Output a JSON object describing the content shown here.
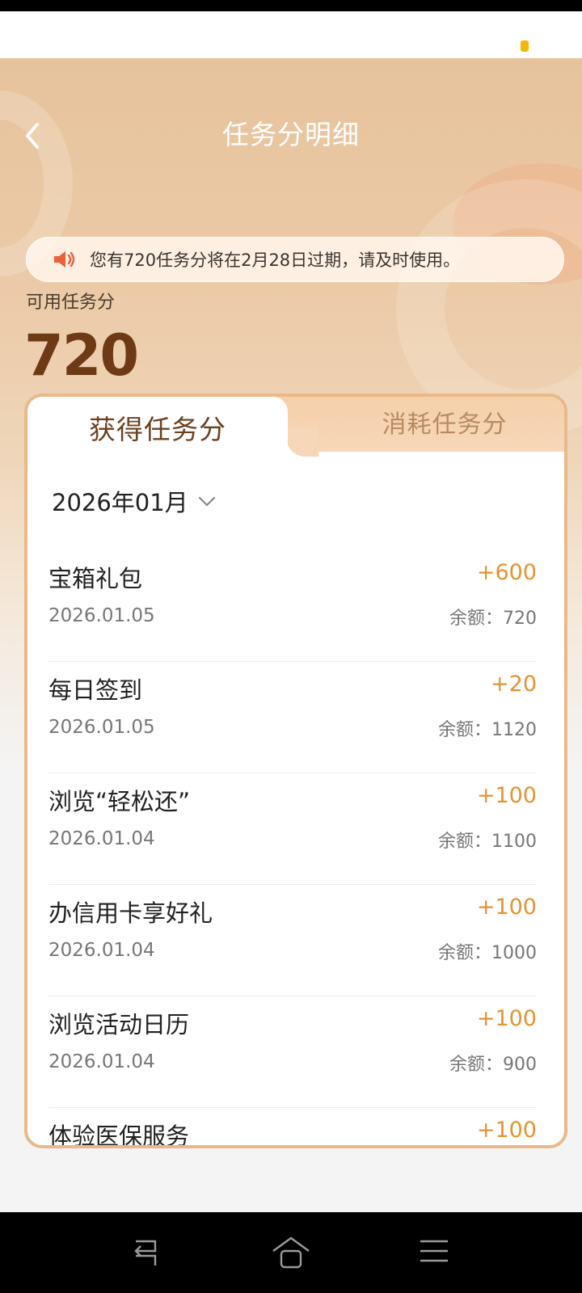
{
  "header": {
    "title": "任务分明细"
  },
  "notice": {
    "text": "您有720任务分将在2月28日过期，请及时使用。"
  },
  "points": {
    "label": "可用任务分",
    "value": "720"
  },
  "tabs": [
    {
      "label": "获得任务分",
      "active": true
    },
    {
      "label": "消耗任务分",
      "active": false
    }
  ],
  "month": {
    "value": "2026年01月"
  },
  "records": [
    {
      "title": "宝箱礼包",
      "date": "2026.01.05",
      "points": "+600",
      "balance": "余额：720"
    },
    {
      "title": "每日签到",
      "date": "2026.01.05",
      "points": "+20",
      "balance": "余额：1120"
    },
    {
      "title": "浏览“轻松还”",
      "date": "2026.01.04",
      "points": "+100",
      "balance": "余额：1100"
    },
    {
      "title": "办信用卡享好礼",
      "date": "2026.01.04",
      "points": "+100",
      "balance": "余额：1000"
    },
    {
      "title": "浏览活动日历",
      "date": "2026.01.04",
      "points": "+100",
      "balance": "余额：900"
    },
    {
      "title": "体验医保服务",
      "date": "",
      "points": "+100",
      "balance": ""
    }
  ],
  "colors": {
    "accent": "#e7932e",
    "brown": "#6e3a15",
    "notice_icon": "#e8603c"
  },
  "icons": {
    "back": "chevron-left-icon",
    "notice": "speaker-icon",
    "dropdown": "chevron-down-icon"
  }
}
